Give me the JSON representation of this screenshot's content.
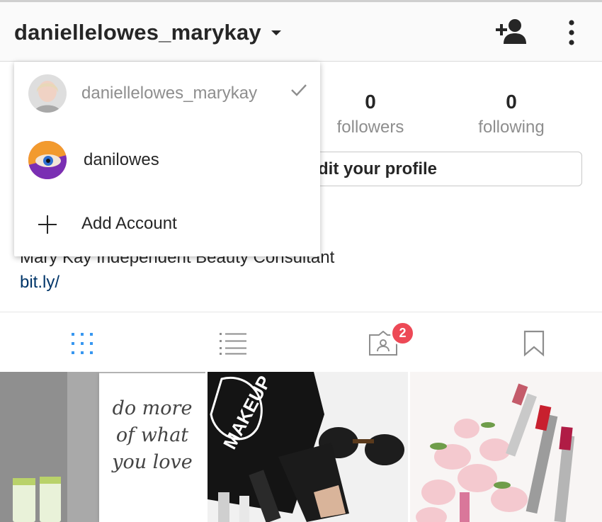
{
  "header": {
    "username": "daniellelowes_marykay"
  },
  "stats": {
    "followers": {
      "value": "0",
      "label": "followers"
    },
    "following": {
      "value": "0",
      "label": "following"
    }
  },
  "profile": {
    "edit_button": "dit your profile",
    "bio": "Mary Kay Independent Beauty Consultant",
    "link": "bit.ly/"
  },
  "tabs": {
    "tagged_badge": "2"
  },
  "account_switcher": {
    "accounts": [
      {
        "username": "daniellelowes_marykay",
        "active": true
      },
      {
        "username": "danilowes",
        "active": false
      }
    ],
    "add_account": "Add Account"
  },
  "posts": [
    {
      "quote_lines": [
        "do more",
        "of what",
        "you love"
      ]
    },
    {
      "text": "MAKEUP"
    },
    {}
  ],
  "colors": {
    "badge": "#ed4956",
    "active_tab": "#3897f0",
    "link": "#003569",
    "muted_text": "#8e8e8e"
  }
}
